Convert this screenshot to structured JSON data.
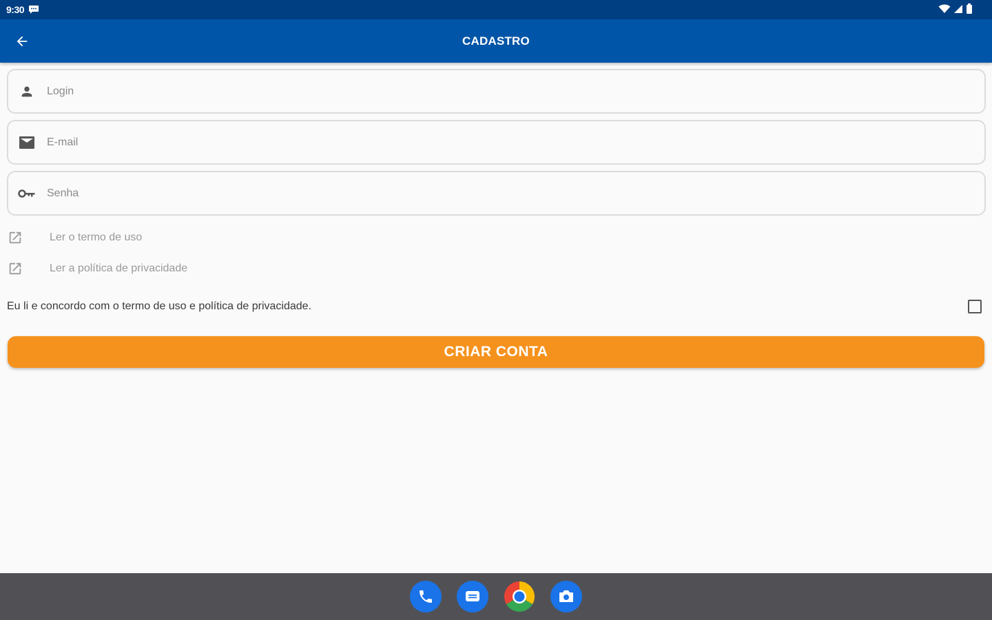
{
  "status_bar": {
    "time": "9:30"
  },
  "app_bar": {
    "title": "CADASTRO"
  },
  "form": {
    "login_placeholder": "Login",
    "email_placeholder": "E-mail",
    "password_placeholder": "Senha",
    "terms_link": "Ler o termo de uso",
    "privacy_link": "Ler a política de privacidade",
    "agree_text": "Eu li e concordo com o termo de uso e política de privacidade.",
    "agree_checked": false,
    "submit_label": "CRIAR CONTA"
  },
  "dock": {
    "apps": [
      "phone-icon",
      "messages-icon",
      "chrome-icon",
      "camera-icon"
    ]
  },
  "colors": {
    "status_bar": "#003f82",
    "app_bar": "#0155a8",
    "accent_button": "#f5921e",
    "nav_bar": "#515155"
  }
}
